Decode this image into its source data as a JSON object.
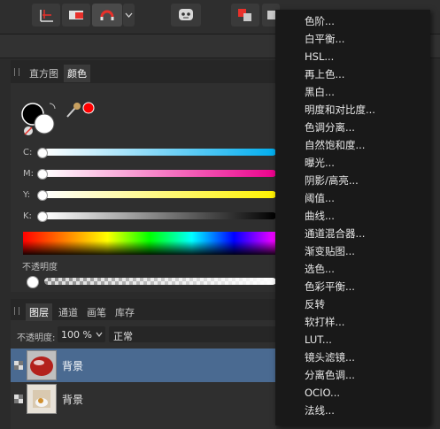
{
  "toolbar": {
    "icons": [
      "grid-icon",
      "toggle-icon",
      "magnet-icon",
      "chevron-down-icon",
      "assistant-icon",
      "arrange-icon"
    ]
  },
  "color_panel": {
    "tabs": [
      {
        "label": "直方图",
        "active": false
      },
      {
        "label": "颜色",
        "active": true
      }
    ],
    "sliders": [
      {
        "label": "C:",
        "gradient": "linear-gradient(90deg,#ffffff,#00aeef)"
      },
      {
        "label": "M:",
        "gradient": "linear-gradient(90deg,#ffffff,#ec008c)"
      },
      {
        "label": "Y:",
        "gradient": "linear-gradient(90deg,#ffffff,#fff200)"
      },
      {
        "label": "K:",
        "gradient": "linear-gradient(90deg,#ffffff,#000000)"
      }
    ],
    "opacity_label": "不透明度",
    "picked_color": "#ff0000",
    "fill_color": "#000000",
    "stroke_color": "#ffffff"
  },
  "layers_panel": {
    "tabs": [
      {
        "label": "图层",
        "active": true
      },
      {
        "label": "通道",
        "active": false
      },
      {
        "label": "画笔",
        "active": false
      },
      {
        "label": "库存",
        "active": false
      }
    ],
    "opacity_label": "不透明度:",
    "opacity_value": "100 %",
    "blend_mode": "正常",
    "layers": [
      {
        "name": "背景",
        "selected": true
      },
      {
        "name": "背景",
        "selected": false
      }
    ]
  },
  "menu": {
    "items": [
      "色阶...",
      "白平衡...",
      "HSL...",
      "再上色...",
      "黑白...",
      "明度和对比度...",
      "色调分离...",
      "自然饱和度...",
      "曝光...",
      "阴影/高亮...",
      "阈值...",
      "曲线...",
      "通道混合器...",
      "渐变贴图...",
      "选色...",
      "色彩平衡...",
      "反转",
      "软打样...",
      "LUT...",
      "镜头滤镜...",
      "分离色调...",
      "OCIO...",
      "法线..."
    ]
  },
  "colors": {
    "accent_red": "#e8302a",
    "selection_blue": "#4a6a91"
  }
}
